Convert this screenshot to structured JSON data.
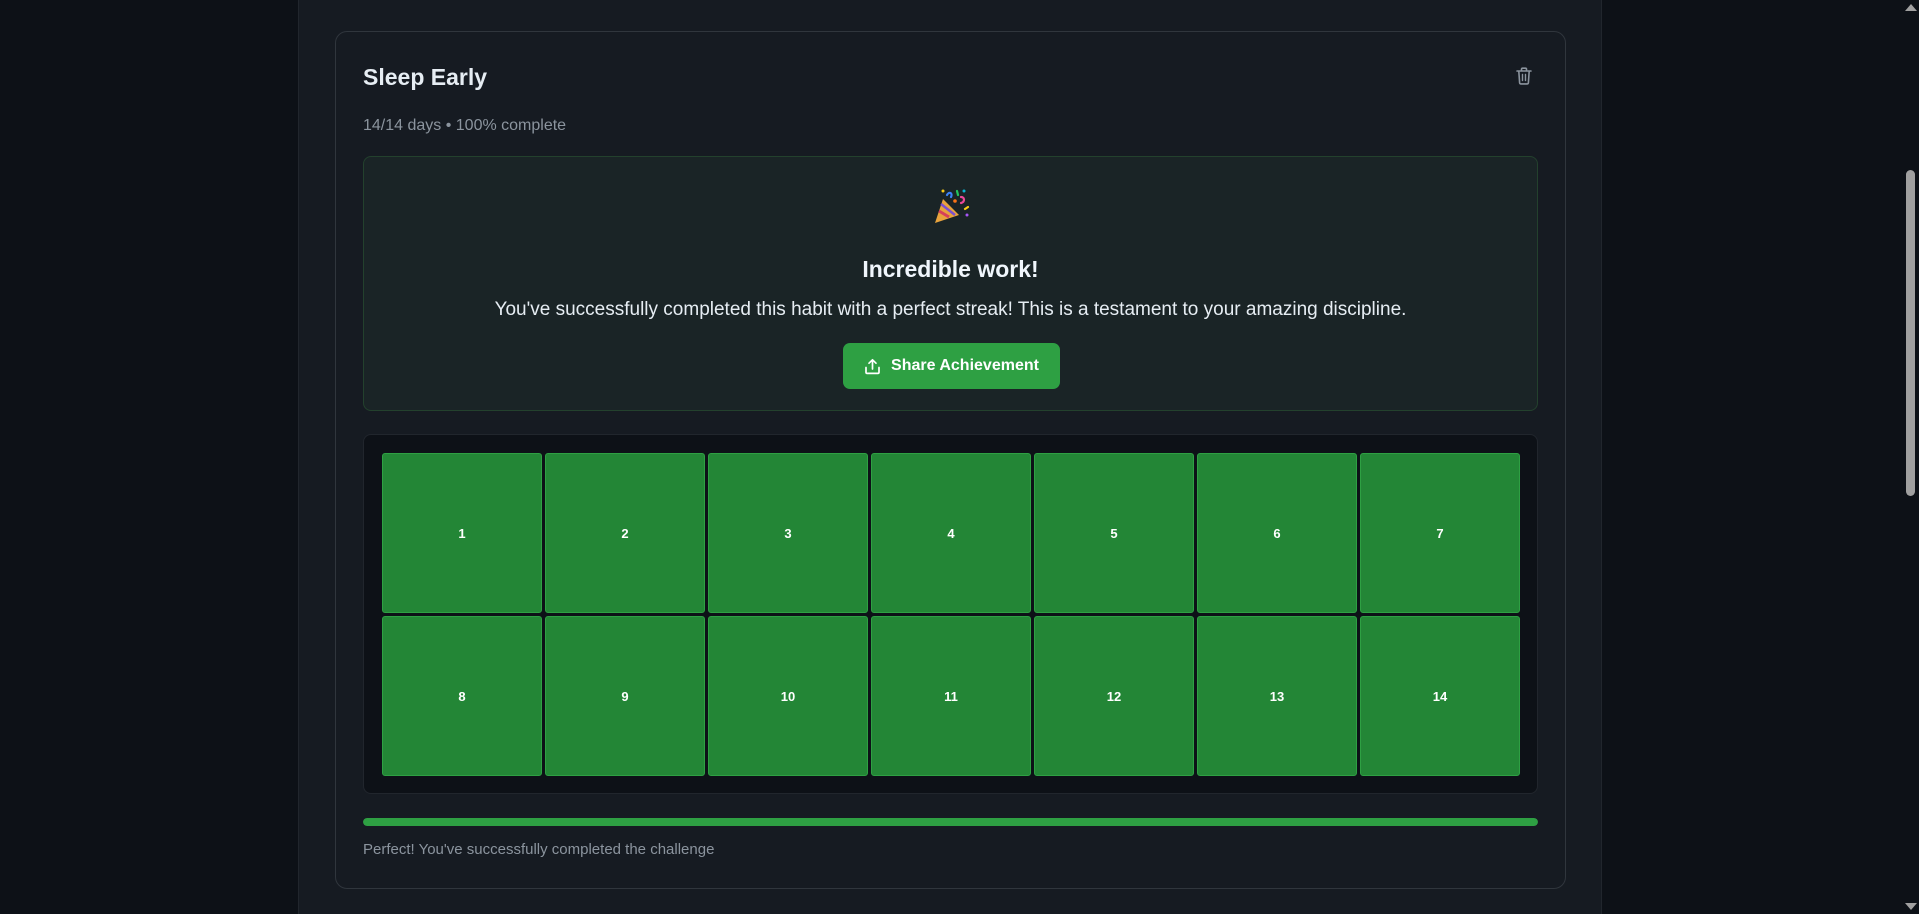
{
  "habit": {
    "title": "Sleep Early",
    "summary": "14/14 days • 100% complete"
  },
  "celebration": {
    "icon": "party-popper-icon",
    "heading": "Incredible work!",
    "message": "You've successfully completed this habit with a perfect streak! This is a testament to your amazing discipline.",
    "share_label": "Share Achievement"
  },
  "days": [
    {
      "label": "1",
      "completed": true
    },
    {
      "label": "2",
      "completed": true
    },
    {
      "label": "3",
      "completed": true
    },
    {
      "label": "4",
      "completed": true
    },
    {
      "label": "5",
      "completed": true
    },
    {
      "label": "6",
      "completed": true
    },
    {
      "label": "7",
      "completed": true
    },
    {
      "label": "8",
      "completed": true
    },
    {
      "label": "9",
      "completed": true
    },
    {
      "label": "10",
      "completed": true
    },
    {
      "label": "11",
      "completed": true
    },
    {
      "label": "12",
      "completed": true
    },
    {
      "label": "13",
      "completed": true
    },
    {
      "label": "14",
      "completed": true
    }
  ],
  "progress": {
    "percent": 100,
    "note": "Perfect! You've successfully completed the challenge"
  },
  "colors": {
    "accent": "#2ea043",
    "completed_day": "#238636",
    "background": "#0d1117",
    "card": "#161b22"
  }
}
